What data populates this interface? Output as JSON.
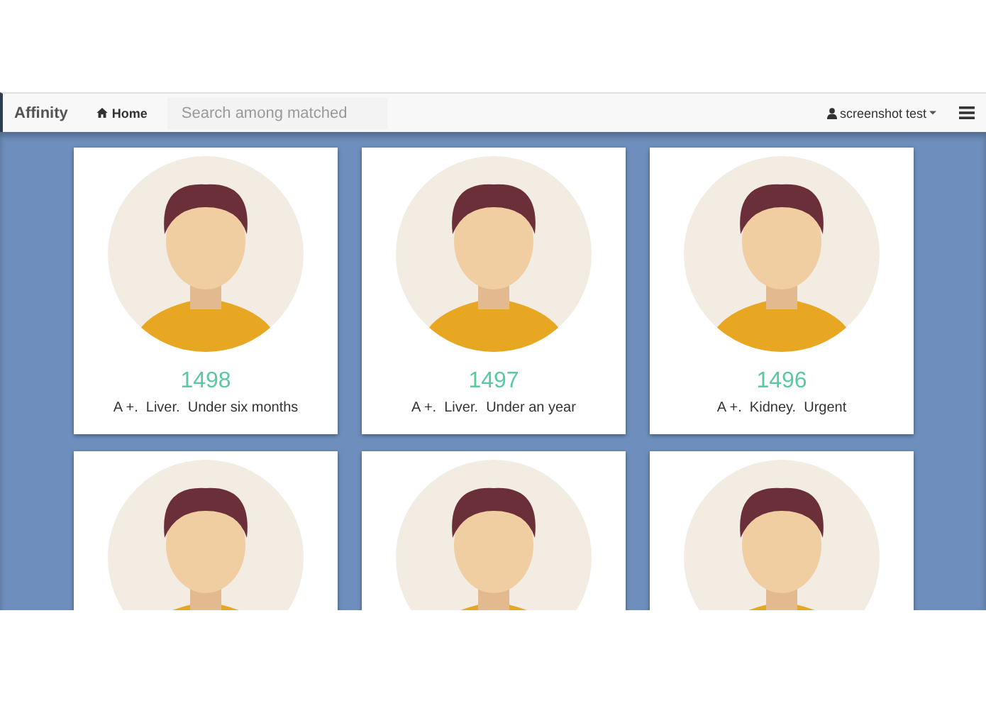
{
  "navbar": {
    "brand": "Affinity",
    "home": "Home",
    "search": {
      "placeholder": "Search among matched"
    },
    "user": "screenshot test"
  },
  "cards": [
    {
      "avatar": true,
      "number": "1498",
      "details": "A +.  Liver.  Under six months"
    },
    {
      "avatar": true,
      "number": "1497",
      "details": "A +.  Liver.  Under an year"
    },
    {
      "avatar": true,
      "number": "1496",
      "details": "A +.  Kidney.  Urgent"
    },
    {
      "avatar": true
    },
    {
      "avatar": true
    },
    {
      "avatar": true
    }
  ]
}
